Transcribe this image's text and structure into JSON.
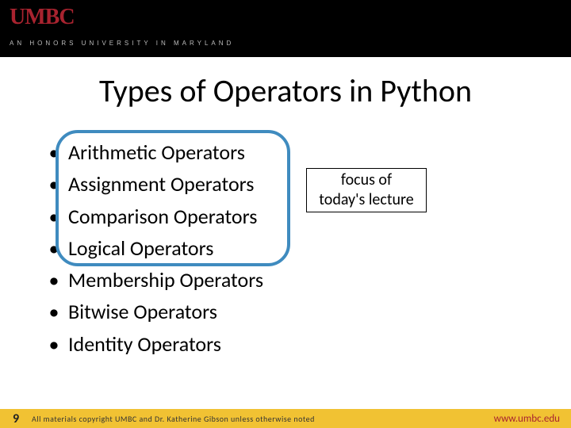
{
  "header": {
    "logo_main": "UMBC",
    "tagline": "AN HONORS UNIVERSITY IN MARYLAND"
  },
  "title": "Types of Operators in Python",
  "bullets": [
    "Arithmetic Operators",
    "Assignment Operators",
    "Comparison Operators",
    "Logical Operators",
    "Membership Operators",
    "Bitwise Operators",
    "Identity Operators"
  ],
  "focus": {
    "line1": "focus of",
    "line2": "today's lecture"
  },
  "footer": {
    "page_number": "9",
    "copyright": "All materials copyright UMBC and Dr. Katherine Gibson unless otherwise noted",
    "url": "www.umbc.edu"
  }
}
